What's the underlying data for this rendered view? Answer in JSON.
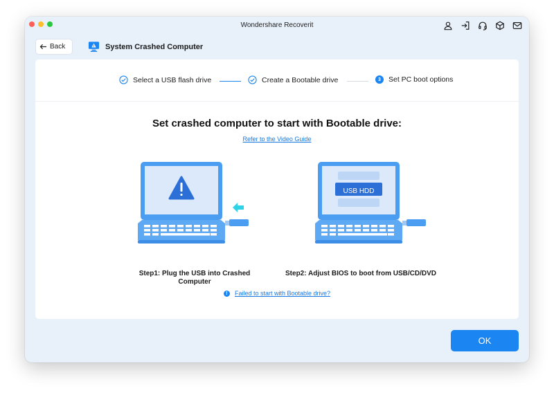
{
  "window": {
    "title": "Wondershare Recoverit"
  },
  "titlebar_icons": [
    {
      "name": "account-icon"
    },
    {
      "name": "sign-in-icon"
    },
    {
      "name": "support-headset-icon"
    },
    {
      "name": "box-icon"
    },
    {
      "name": "mail-icon"
    }
  ],
  "header": {
    "back_label": "Back",
    "page_title": "System Crashed Computer"
  },
  "stepper": {
    "steps": [
      {
        "label": "Select a USB flash drive",
        "state": "done"
      },
      {
        "label": "Create a Bootable drive",
        "state": "done"
      },
      {
        "number": "3",
        "label": "Set PC boot options",
        "state": "active"
      }
    ]
  },
  "main": {
    "heading": "Set crashed computer to start with Bootable drive:",
    "video_link": "Refer to the Video Guide",
    "step1_caption_line1": "Step1:  Plug the USB into Crashed",
    "step1_caption_line2": "Computer",
    "step2_caption": "Step2: Adjust BIOS to boot from USB/CD/DVD",
    "bios_label": "USB HDD",
    "failed_link": "Failed to start with Bootable drive?",
    "info_glyph": "!"
  },
  "footer": {
    "ok_label": "OK"
  },
  "colors": {
    "accent": "#1b86f1",
    "laptop_blue": "#4a9df0",
    "arrow_cyan": "#2fd3e6",
    "warning": "#2c6fd6"
  }
}
